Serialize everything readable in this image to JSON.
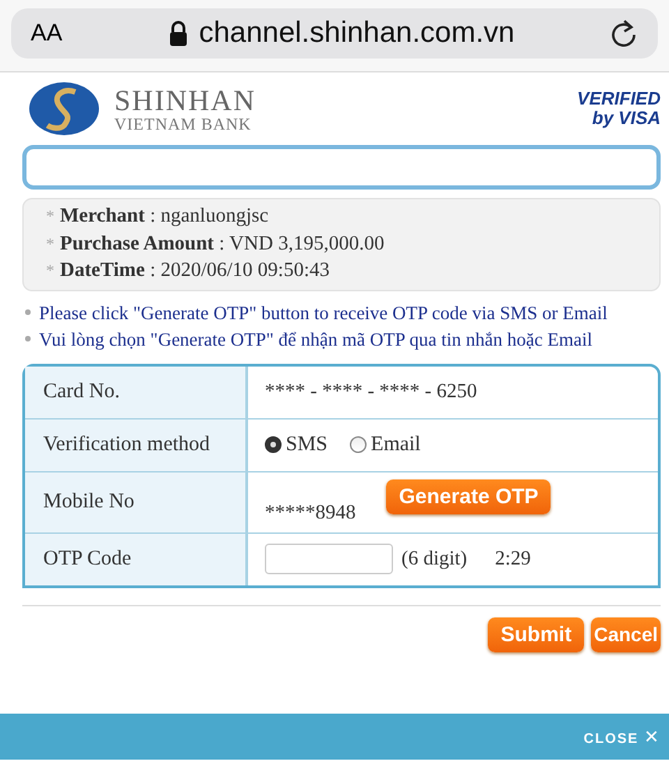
{
  "browser": {
    "text_size": "AA",
    "url": "channel.shinhan.com.vn"
  },
  "header": {
    "bank_name": "SHINHAN",
    "bank_sub": "VIETNAM BANK",
    "verified": "VERIFIED",
    "by_visa": "by VISA"
  },
  "info": [
    {
      "marker": "*",
      "label": "Merchant",
      "value": " : nganluongjsc"
    },
    {
      "marker": "*",
      "label": "Purchase Amount",
      "value": " : VND 3,195,000.00"
    },
    {
      "marker": "*",
      "label": "DateTime",
      "value": " : 2020/06/10 09:50:43"
    }
  ],
  "notes": [
    "Please click \"Generate OTP\" button to receive OTP code via SMS or Email",
    "Vui lòng chọn \"Generate OTP\" để nhận mã OTP qua tin nhắn hoặc Email"
  ],
  "form": {
    "card_label": "Card No.",
    "card_value": "**** - **** - **** - 6250",
    "method_label": "Verification method",
    "methods": [
      {
        "label": "SMS",
        "selected": true
      },
      {
        "label": "Email",
        "selected": false
      }
    ],
    "mobile_label": "Mobile No",
    "mobile_value": "*****8948",
    "generate": "Generate OTP",
    "otp_label": "OTP Code",
    "otp_hint": "(6 digit)",
    "timer": "2:29"
  },
  "buttons": {
    "submit": "Submit",
    "cancel": "Cancel"
  },
  "footer": {
    "close": "CLOSE",
    "close_icon": "✕"
  }
}
